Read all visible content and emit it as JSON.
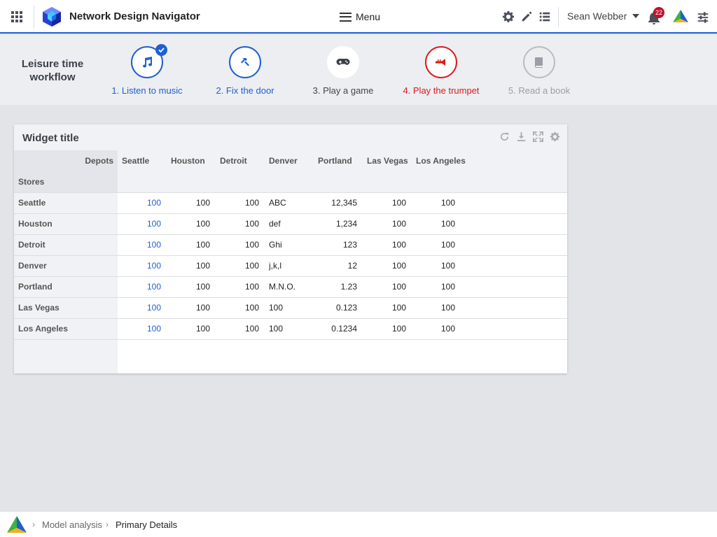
{
  "header": {
    "app_title": "Network Design Navigator",
    "menu_label": "Menu",
    "user_name": "Sean Webber",
    "notification_count": "22"
  },
  "workflow": {
    "title": "Leisure time workflow",
    "steps": [
      {
        "label": "1. Listen to music",
        "state": "completed",
        "icon": "music-note-icon"
      },
      {
        "label": "2. Fix the door",
        "state": "active",
        "icon": "hammer-icon"
      },
      {
        "label": "3. Play a game",
        "state": "default",
        "icon": "gamepad-icon"
      },
      {
        "label": "4. Play the trumpet",
        "state": "error",
        "icon": "trumpet-icon"
      },
      {
        "label": "5. Read a book",
        "state": "disabled",
        "icon": "book-icon"
      }
    ]
  },
  "widget": {
    "title": "Widget title",
    "corner_top": "Depots",
    "corner_left": "Stores",
    "columns": [
      "Seattle",
      "Houston",
      "Detroit",
      "Denver",
      "Portland",
      "Las Vegas",
      "Los Angeles"
    ],
    "rows": [
      {
        "name": "Seattle",
        "cells": [
          "100",
          "100",
          "100",
          "ABC",
          "12,345",
          "100",
          "100"
        ]
      },
      {
        "name": "Houston",
        "cells": [
          "100",
          "100",
          "100",
          "def",
          "1,234",
          "100",
          "100"
        ]
      },
      {
        "name": "Detroit",
        "cells": [
          "100",
          "100",
          "100",
          "Ghi",
          "123",
          "100",
          "100"
        ]
      },
      {
        "name": "Denver",
        "cells": [
          "100",
          "100",
          "100",
          "j,k,l",
          "12",
          "100",
          "100"
        ]
      },
      {
        "name": "Portland",
        "cells": [
          "100",
          "100",
          "100",
          "M.N.O.",
          "1.23",
          "100",
          "100"
        ]
      },
      {
        "name": "Las Vegas",
        "cells": [
          "100",
          "100",
          "100",
          "100",
          "0.123",
          "100",
          "100"
        ]
      },
      {
        "name": "Los Angeles",
        "cells": [
          "100",
          "100",
          "100",
          "100",
          "0.1234",
          "100",
          "100"
        ]
      }
    ]
  },
  "breadcrumb": {
    "items": [
      "Model analysis",
      "Primary Details"
    ]
  },
  "colors": {
    "accent": "#1f5fd1",
    "error": "#dd1a1a",
    "badge": "#c0102a"
  }
}
